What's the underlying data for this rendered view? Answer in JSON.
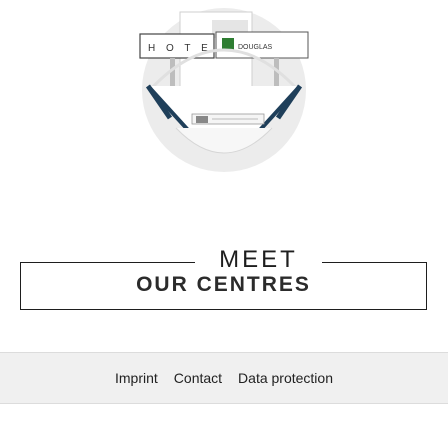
{
  "hero": {
    "hotel_logo_text": "HOTELS",
    "douglas_logo_text": "DOUGLAS"
  },
  "meet": {
    "title": "MEET",
    "subtitle": "OUR CENTRES"
  },
  "footer": {
    "links": [
      "Imprint",
      "Contact",
      "Data protection"
    ]
  },
  "colors": {
    "accent": "#2196c8",
    "text": "#1e1e1e",
    "footer_bg": "#f0f0f0"
  }
}
